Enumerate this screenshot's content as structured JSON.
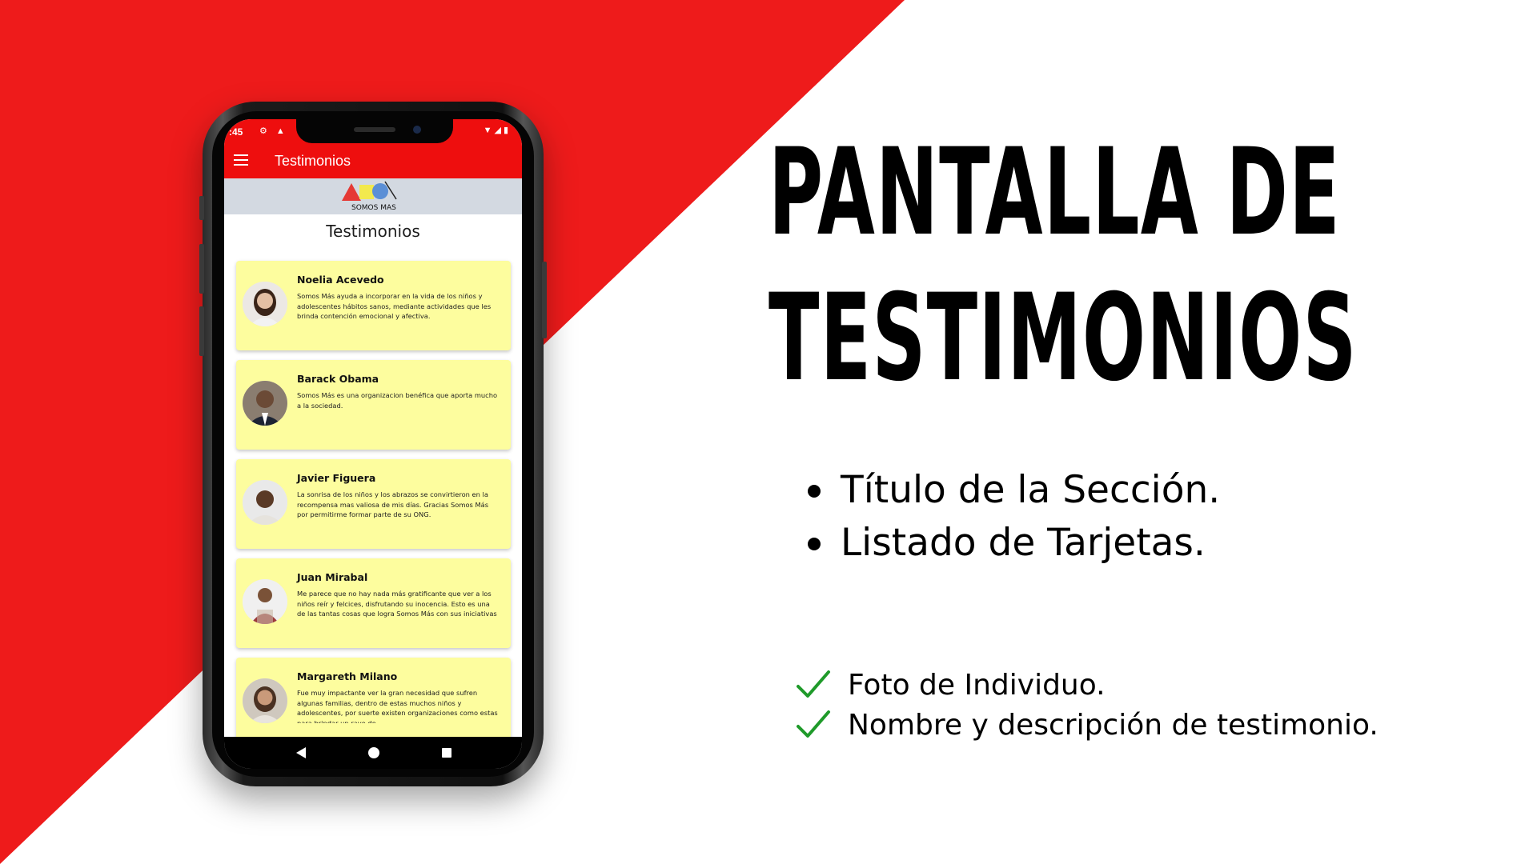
{
  "colors": {
    "accent_red": "#ee0e0e",
    "card_yellow": "#fdfd9e",
    "logo_band": "#d3d9e1",
    "check_green": "#1f9a2a"
  },
  "phone": {
    "status_bar": {
      "time": ":45",
      "left_icons": "⚙ ▲",
      "right_icons": "▼◢▮"
    },
    "app_bar": {
      "menu_icon": "hamburger-menu-icon",
      "title": "Testimonios"
    },
    "logo_text": "SOMOS MAS",
    "section_title": "Testimonios",
    "testimonials": [
      {
        "name": "Noelia Acevedo",
        "text": "Somos Más ayuda a incorporar en la vida de los niños y adolescentes hábitos sanos, mediante actividades que les brinda contención emocional y afectiva."
      },
      {
        "name": "Barack Obama",
        "text": "Somos Más es una organizacion benéfica que aporta mucho a la sociedad."
      },
      {
        "name": "Javier Figuera",
        "text": "La sonrisa de los niños y los abrazos se convirtieron en la recompensa mas valiosa de mis días. Gracias Somos Más por permitirme formar parte de su ONG."
      },
      {
        "name": "Juan Mirabal",
        "text": "Me parece que no hay nada más gratificante que ver a los niños reír y felcices, disfrutando su inocencia. Esto es una de las tantas cosas que logra Somos Más con sus iniciativas"
      },
      {
        "name": "Margareth Milano",
        "text": "Fue muy impactante ver la gran necesidad que sufren algunas familias, dentro de estas muchos niños y adolescentes, por suerte existen organizaciones como estas para brindar un rayo de"
      }
    ]
  },
  "headline": {
    "line1": "PANTALLA DE",
    "line2": "TESTIMONIOS"
  },
  "bullets": [
    "Título de la Sección.",
    "Listado de Tarjetas."
  ],
  "checks": [
    "Foto de Individuo.",
    "Nombre y descripción de testimonio."
  ]
}
